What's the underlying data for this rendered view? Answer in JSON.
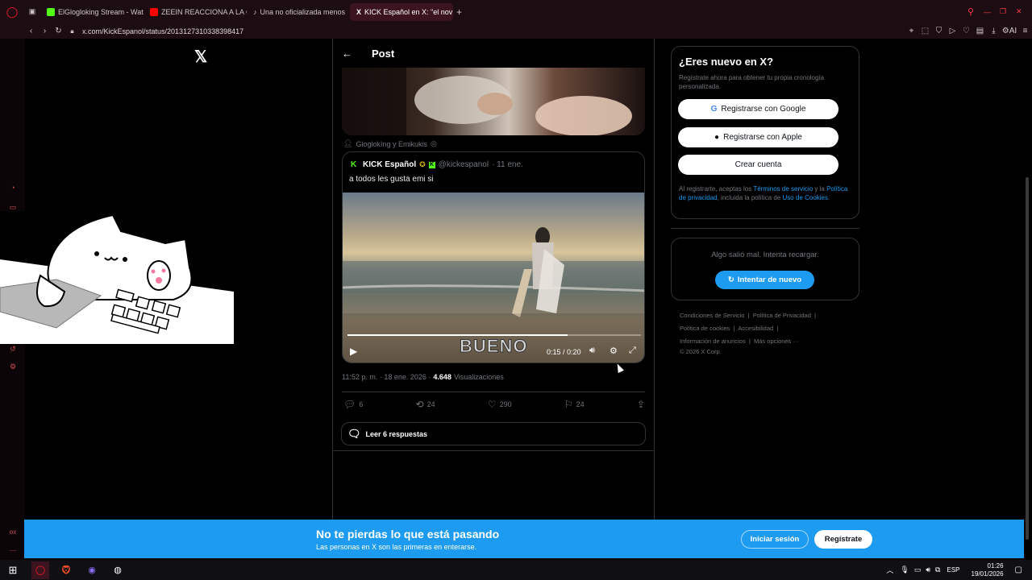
{
  "browser": {
    "tabs": [
      {
        "label": "ElGlogloking Stream - Wat",
        "color": "#53fc18"
      },
      {
        "label": "ZEEIN REACCIONA A LA C",
        "color": "#ff0000"
      },
      {
        "label": "Una no oficializada menos",
        "color": "#111111"
      },
      {
        "label": "KICK Español en X: \"el nov",
        "color": "#000000"
      }
    ],
    "url": "x.com/KickEspanol/status/2013127310338398417",
    "new_tab": "+"
  },
  "post_header": {
    "title": "Post"
  },
  "retweet_line": "Gloglokìng y Emikukis",
  "quoted": {
    "name": "KICK Español",
    "handle": "@kickespanol",
    "date": "· 11 ene.",
    "text": "a todos les gusta emi si"
  },
  "video": {
    "caption": "BUENO",
    "time": "0:15 / 0:20",
    "progress": 0.75
  },
  "post_meta": {
    "time": "11:52 p. m. · 18 ene. 2026 ·",
    "views_count": "4.648",
    "views_label": "Visualizaciones"
  },
  "actions": {
    "replies": "6",
    "reposts": "24",
    "likes": "290",
    "bookmarks": "24"
  },
  "read_replies": "Leer 6 respuestas",
  "signup": {
    "title": "¿Eres nuevo en X?",
    "subtitle": "Regístrate ahora para obtener tu propia cronología personalizada.",
    "google": "Registrarse con Google",
    "apple": "Registrarse con Apple",
    "create": "Crear cuenta",
    "legal_a": "Al registrarte, aceptas los ",
    "legal_terms": "Términos de servicio",
    "legal_b": " y la ",
    "legal_privacy": "Política de privacidad",
    "legal_c": ", incluida la política de ",
    "legal_cookies": "Uso de Cookies",
    "legal_d": "."
  },
  "error_card": {
    "message": "Algo salió mal. Intenta recargar.",
    "retry": "Intentar de nuevo"
  },
  "footer": {
    "row1": [
      "Condiciones de Servicio",
      "Política de Privacidad"
    ],
    "row2": [
      "Política de cookies",
      "Accesibilidad"
    ],
    "row3": [
      "Información de anuncios",
      "Más opciones ···"
    ],
    "copyright": "© 2026 X Corp."
  },
  "banner": {
    "title": "No te pierdas lo que está pasando",
    "subtitle": "Las personas en X son las primeras en enterarse.",
    "login": "Iniciar sesión",
    "register": "Regístrate"
  },
  "taskbar": {
    "lang": "ESP",
    "time": "01:26",
    "date": "19/01/2026"
  },
  "sidebar_left": {
    "bottom_label": "ox"
  }
}
